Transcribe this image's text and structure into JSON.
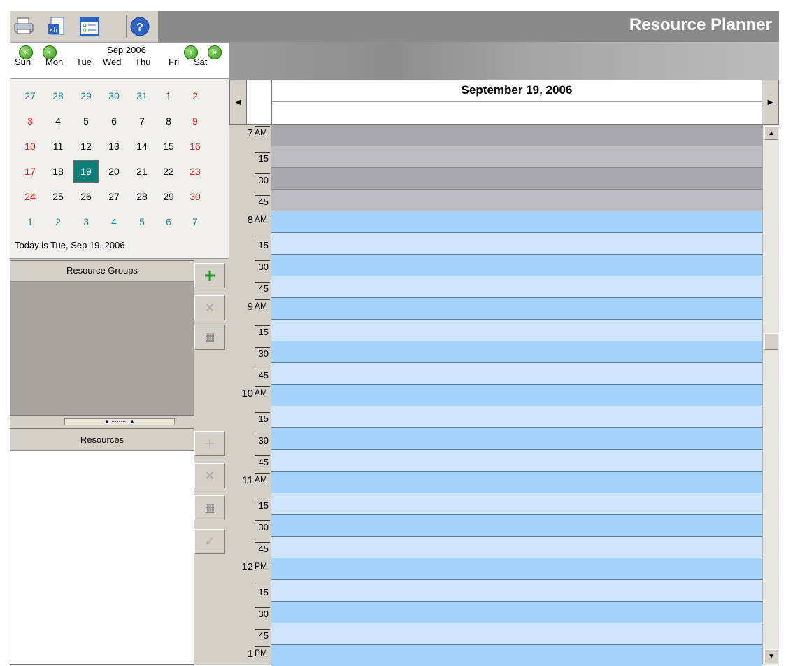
{
  "toolbar": {
    "title": "Resource Planner",
    "buttons": [
      "print-icon",
      "html-export-icon",
      "options-icon",
      "help-icon"
    ]
  },
  "calendar": {
    "month_label": "Sep 2006",
    "weekdays": [
      "Sun",
      "Mon",
      "Tue",
      "Wed",
      "Thu",
      "Fri",
      "Sat"
    ],
    "weeks": [
      [
        "27",
        "28",
        "29",
        "30",
        "31",
        "1",
        "2"
      ],
      [
        "3",
        "4",
        "5",
        "6",
        "7",
        "8",
        "9"
      ],
      [
        "10",
        "11",
        "12",
        "13",
        "14",
        "15",
        "16"
      ],
      [
        "17",
        "18",
        "19",
        "20",
        "21",
        "22",
        "23"
      ],
      [
        "24",
        "25",
        "26",
        "27",
        "28",
        "29",
        "30"
      ],
      [
        "1",
        "2",
        "3",
        "4",
        "5",
        "6",
        "7"
      ]
    ],
    "selected_day": "19",
    "today_text": "Today is Tue, Sep 19, 2006"
  },
  "groups": {
    "header": "Resource Groups"
  },
  "resources": {
    "header": "Resources"
  },
  "schedule": {
    "date_title": "September 19, 2006",
    "slots": [
      {
        "hour": "7",
        "ampm": "AM",
        "min": "15",
        "min2": "30",
        "min3": "45"
      },
      {
        "hour": "8",
        "ampm": "AM",
        "min": "15",
        "min2": "30",
        "min3": "45"
      },
      {
        "hour": "9",
        "ampm": "AM",
        "min": "15",
        "min2": "30",
        "min3": "45"
      },
      {
        "hour": "10",
        "ampm": "AM",
        "min": "15",
        "min2": "30",
        "min3": "45"
      },
      {
        "hour": "11",
        "ampm": "AM",
        "min": "15",
        "min2": "30",
        "min3": "45"
      },
      {
        "hour": "12",
        "ampm": "PM",
        "min": "15",
        "min2": "30",
        "min3": "45"
      },
      {
        "hour": "1",
        "ampm": "PM"
      }
    ]
  },
  "colors": {
    "offhours_dark": "#a9a9ad",
    "offhours_light": "#bdbdc1",
    "work_dark": "#a6d3fb",
    "work_light": "#cfe5fb",
    "today_bg": "#0f7f7a",
    "weekend_red": "#d91f1f",
    "other_month": "#1a8a8a"
  }
}
